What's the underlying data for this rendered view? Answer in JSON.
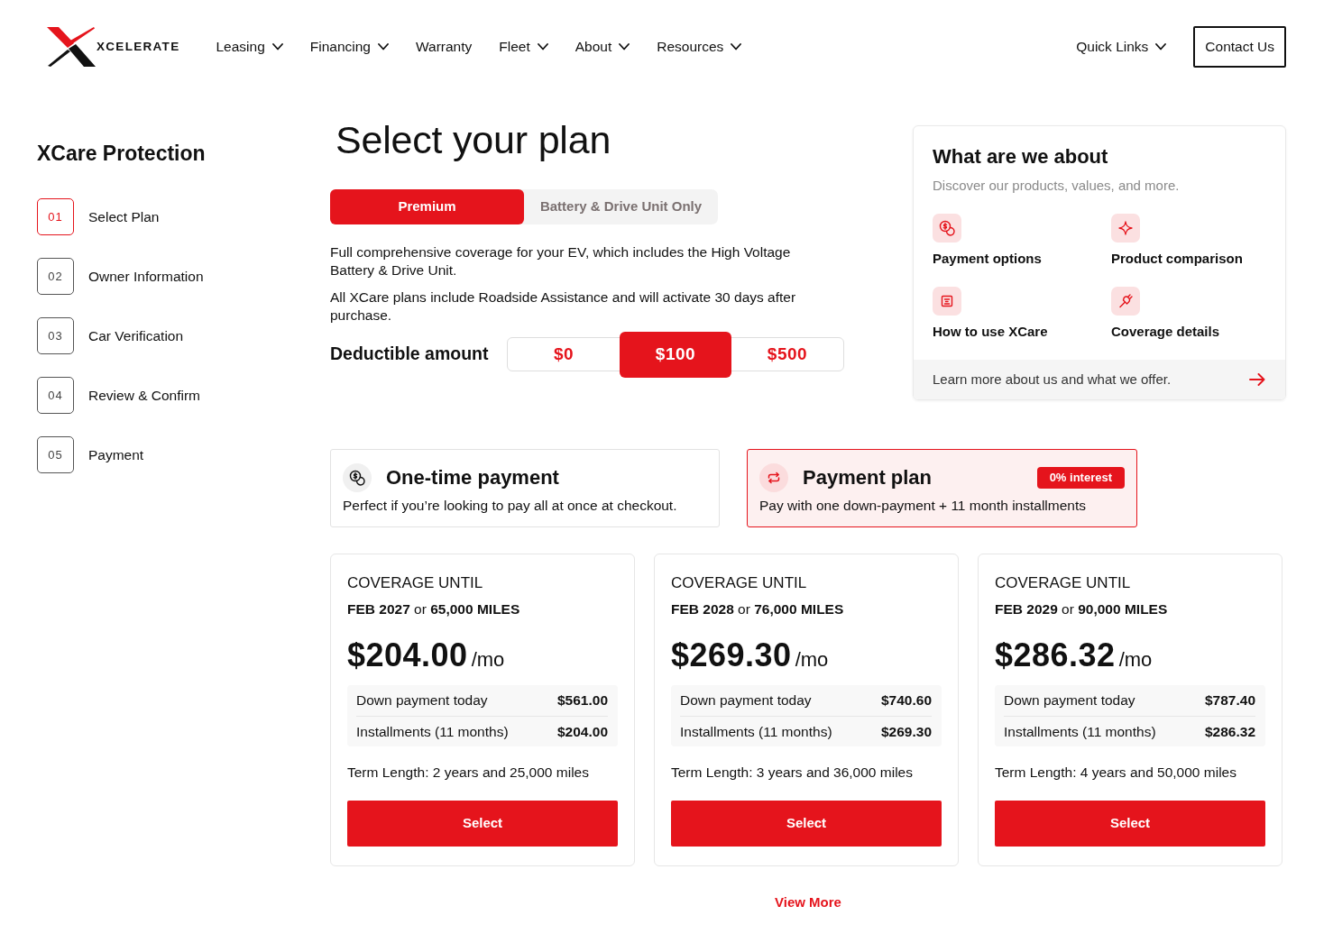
{
  "header": {
    "logo_text": "XCELERATE",
    "nav": [
      {
        "label": "Leasing",
        "has_menu": true
      },
      {
        "label": "Financing",
        "has_menu": true
      },
      {
        "label": "Warranty",
        "has_menu": false
      },
      {
        "label": "Fleet",
        "has_menu": true
      },
      {
        "label": "About",
        "has_menu": true
      },
      {
        "label": "Resources",
        "has_menu": true
      }
    ],
    "quick_links": {
      "label": "Quick Links",
      "has_menu": true
    },
    "contact_button": "Contact Us"
  },
  "sidebar": {
    "title": "XCare Protection",
    "steps": [
      {
        "number": "01",
        "label": "Select Plan",
        "selected": true
      },
      {
        "number": "02",
        "label": "Owner Information",
        "selected": false
      },
      {
        "number": "03",
        "label": "Car Verification",
        "selected": false
      },
      {
        "number": "04",
        "label": "Review & Confirm",
        "selected": false
      },
      {
        "number": "05",
        "label": "Payment",
        "selected": false
      }
    ]
  },
  "plan_selector": {
    "title": "Select your plan",
    "tabs": [
      {
        "label": "Premium",
        "selected": true
      },
      {
        "label": "Battery & Drive Unit Only",
        "selected": false
      }
    ],
    "descriptions": [
      "Full comprehensive coverage for your EV, which includes the High Voltage Battery & Drive Unit.",
      "All XCare plans include Roadside Assistance and will activate 30 days after purchase."
    ],
    "deductible": {
      "label": "Deductible amount",
      "options": [
        {
          "label": "$0",
          "selected": false
        },
        {
          "label": "$100",
          "selected": true
        },
        {
          "label": "$500",
          "selected": false
        }
      ]
    }
  },
  "about_panel": {
    "title": "What are we about",
    "subtitle": "Discover our products, values, and more.",
    "links": [
      "Payment options",
      "Product comparison",
      "How to use XCare",
      "Coverage details"
    ],
    "footer_link": "Learn more about us and what we offer."
  },
  "payment_types": [
    {
      "title": "One-time payment",
      "description": "Perfect if you’re looking to pay all at once at checkout.",
      "selected": false
    },
    {
      "title": "Payment plan",
      "description": "Pay with one down-payment + 11 month installments",
      "badge": "0% interest",
      "selected": true
    }
  ],
  "plans": [
    {
      "coverage_label": "COVERAGE UNTIL",
      "coverage_limit": "**FEB 2027** or **65,000 MILES**",
      "price": "$204.00",
      "price_unit": "/mo",
      "breakdown": [
        {
          "label": "Down payment today",
          "value": "$561.00"
        },
        {
          "label": "Installments (11 months)",
          "value": "$204.00"
        }
      ],
      "term": "Term Length: 2 years and 25,000 miles",
      "button": "Select"
    },
    {
      "coverage_label": "COVERAGE UNTIL",
      "coverage_limit": "**FEB 2028** or **76,000 MILES**",
      "price": "$269.30",
      "price_unit": "/mo",
      "breakdown": [
        {
          "label": "Down payment today",
          "value": "$740.60"
        },
        {
          "label": "Installments (11 months)",
          "value": "$269.30"
        }
      ],
      "term": "Term Length: 3 years and 36,000 miles",
      "button": "Select"
    },
    {
      "coverage_label": "COVERAGE UNTIL",
      "coverage_limit": "**FEB 2029** or **90,000 MILES**",
      "price": "$286.32",
      "price_unit": "/mo",
      "breakdown": [
        {
          "label": "Down payment today",
          "value": "$787.40"
        },
        {
          "label": "Installments (11 months)",
          "value": "$286.32"
        }
      ],
      "term": "Term Length: 4 years and 50,000 miles",
      "button": "Select"
    }
  ],
  "view_more": "View More"
}
